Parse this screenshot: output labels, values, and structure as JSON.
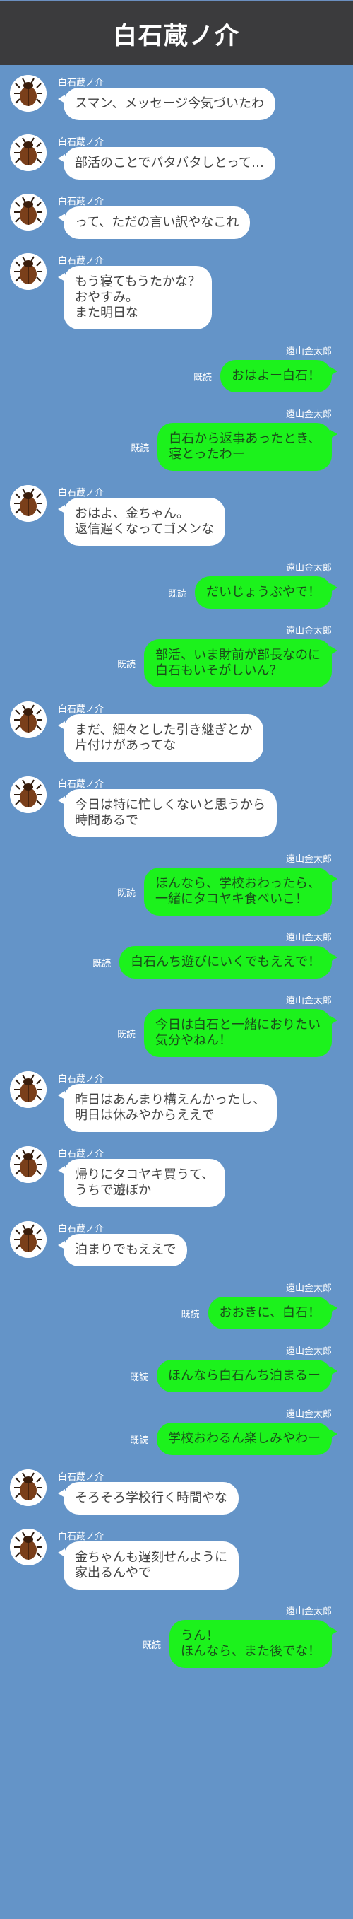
{
  "header": {
    "title": "白石蔵ノ介"
  },
  "incoming_name": "白石蔵ノ介",
  "outgoing_name": "遠山金太郎",
  "read_label": "既読",
  "colors": {
    "background": "#6494c8",
    "header": "#3b3b3d",
    "outgoing_bubble": "#1cf21c",
    "incoming_bubble": "#ffffff"
  },
  "avatar_icon": "beetle-icon",
  "messages": [
    {
      "from": "in",
      "text": "スマン、メッセージ今気づいたわ"
    },
    {
      "from": "in",
      "text": "部活のことでバタバタしとって…"
    },
    {
      "from": "in",
      "text": "って、ただの言い訳やなこれ"
    },
    {
      "from": "in",
      "text": "もう寝てもうたかな？\nおやすみ。\nまた明日な"
    },
    {
      "from": "out",
      "text": "おはよー白石！"
    },
    {
      "from": "out",
      "text": "白石から返事あったとき、\n寝とったわー"
    },
    {
      "from": "in",
      "text": "おはよ、金ちゃん。\n返信遅くなってゴメンな"
    },
    {
      "from": "out",
      "text": "だいじょうぶやで！"
    },
    {
      "from": "out",
      "text": "部活、いま財前が部長なのに\n白石もいそがしいん？"
    },
    {
      "from": "in",
      "text": "まだ、細々とした引き継ぎとか\n片付けがあってな"
    },
    {
      "from": "in",
      "text": "今日は特に忙しくないと思うから\n時間あるで"
    },
    {
      "from": "out",
      "text": "ほんなら、学校おわったら、\n一緒にタコヤキ食べいこ！"
    },
    {
      "from": "out",
      "text": "白石んち遊びにいくでもええで！"
    },
    {
      "from": "out",
      "text": "今日は白石と一緒におりたい\n気分やねん！"
    },
    {
      "from": "in",
      "text": "昨日はあんまり構えんかったし、\n明日は休みやからええで"
    },
    {
      "from": "in",
      "text": "帰りにタコヤキ買うて、\nうちで遊ぼか"
    },
    {
      "from": "in",
      "text": "泊まりでもええで"
    },
    {
      "from": "out",
      "text": "おおきに、白石！"
    },
    {
      "from": "out",
      "text": "ほんなら白石んち泊まるー"
    },
    {
      "from": "out",
      "text": "学校おわるん楽しみやわー"
    },
    {
      "from": "in",
      "text": "そろそろ学校行く時間やな"
    },
    {
      "from": "in",
      "text": "金ちゃんも遅刻せんように\n家出るんやで"
    },
    {
      "from": "out",
      "text": "うん！\nほんなら、また後でな！"
    }
  ]
}
